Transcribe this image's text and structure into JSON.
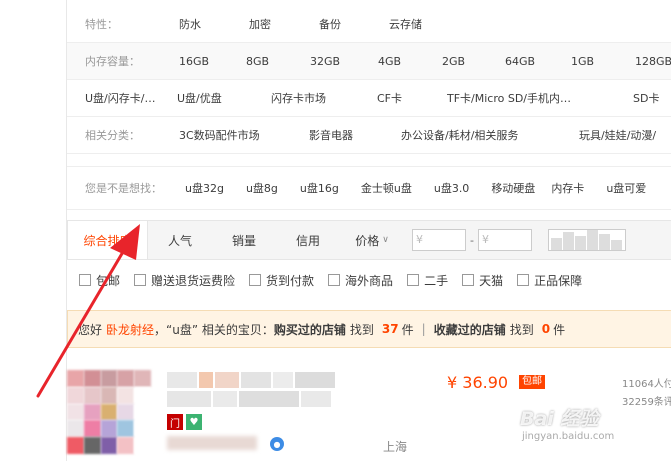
{
  "attributes": {
    "feature": {
      "key": "特性：",
      "values": [
        "防水",
        "加密",
        "备份",
        "云存储"
      ]
    },
    "memory": {
      "key": "内存容量：",
      "values": [
        "16GB",
        "8GB",
        "32GB",
        "4GB",
        "2GB",
        "64GB",
        "1GB",
        "128GB"
      ]
    },
    "type": {
      "key": "U盘/闪存卡/…",
      "values": [
        "U盘/优盘",
        "闪存卡市场",
        "CF卡",
        "TF卡/Micro SD/手机内…",
        "SD卡"
      ]
    },
    "related": {
      "key": "相关分类：",
      "values": [
        "3C数码配件市场",
        "影音电器",
        "办公设备/耗材/相关服务",
        "玩具/娃娃/动漫/"
      ]
    }
  },
  "suggest": {
    "key": "您是不是想找：",
    "values": [
      "u盘32g",
      "u盘8g",
      "u盘16g",
      "金士顿u盘",
      "u盘3.0",
      "移动硬盘",
      "内存卡",
      "u盘可爱"
    ]
  },
  "sortbar": {
    "items": [
      "综合排序",
      "人气",
      "销量",
      "信用",
      "价格"
    ],
    "price_from_placeholder": "¥",
    "price_to_placeholder": "¥",
    "dash": "-"
  },
  "filters": [
    "包邮",
    "赠送退货运费险",
    "货到付款",
    "海外商品",
    "二手",
    "天猫",
    "正品保障"
  ],
  "notice": {
    "greeting": "您好",
    "user": "卧龙射经",
    "query_part": "，“u盘” 相关的宝贝：",
    "bought_label": "购买过的店铺",
    "found1": "找到",
    "count1": "37",
    "unit1": "件",
    "divider": "|",
    "fav_label": "收藏过的店铺",
    "found2": "找到",
    "count2": "0",
    "unit2": "件"
  },
  "product": {
    "price": "¥ 36.90",
    "shipping_badge": "包邮",
    "sold": "11064人付",
    "reviews": "32259条评",
    "location": "上海"
  },
  "watermark": {
    "brand": "Bai 经验",
    "url": "jingyan.baidu.com"
  },
  "colors": {
    "accent": "#ff4400",
    "arrow": "#e8242b"
  }
}
